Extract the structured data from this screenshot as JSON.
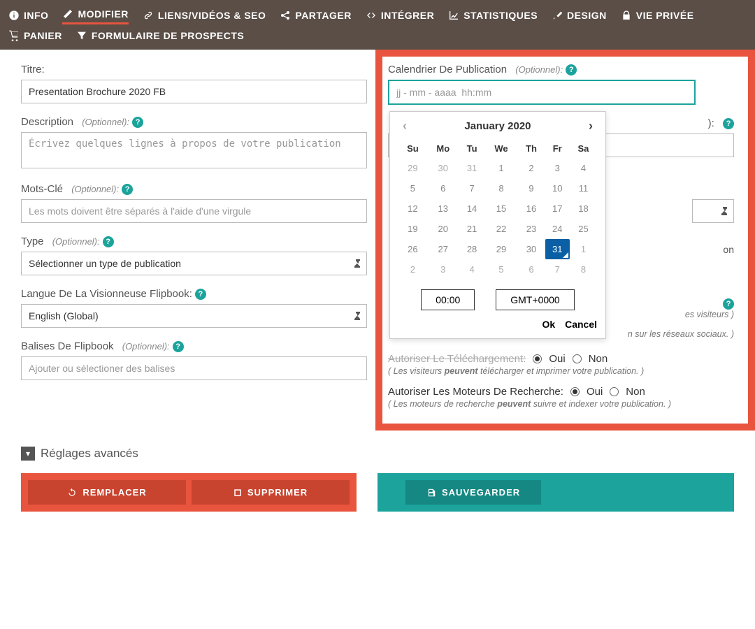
{
  "nav": {
    "info": "INFO",
    "modifier": "MODIFIER",
    "liens": "LIENS/VIDÉOS & SEO",
    "partager": "PARTAGER",
    "integrer": "INTÉGRER",
    "stats": "STATISTIQUES",
    "design": "DESIGN",
    "privacy": "VIE PRIVÉE",
    "panier": "PANIER",
    "leads": "FORMULAIRE DE PROSPECTS"
  },
  "left": {
    "titre_label": "Titre:",
    "titre_value": "Presentation Brochure 2020 FB",
    "desc_label": "Description",
    "desc_opt": "(Optionnel):",
    "desc_placeholder": "Écrivez quelques lignes à propos de votre publication",
    "keywords_label": "Mots-Clé",
    "keywords_opt": "(Optionnel):",
    "keywords_placeholder": "Les mots doivent être séparés à l'aide d'une virgule",
    "type_label": "Type",
    "type_opt": "(Optionnel):",
    "type_value": "Sélectionner un type de publication",
    "lang_label": "Langue De La Visionneuse Flipbook:",
    "lang_value": "English (Global)",
    "tags_label": "Balises De Flipbook",
    "tags_opt": "(Optionnel):",
    "tags_placeholder": "Ajouter ou sélectioner des balises"
  },
  "right": {
    "schedule_label": "Calendrier De Publication",
    "schedule_opt": "(Optionnel):",
    "schedule_placeholder": "jj - mm - aaaa  hh:mm",
    "hint_visitors": "es visiteurs )",
    "hint_social_suffix": "n sur les réseaux sociaux. )",
    "fragment_on": "on",
    "download_label": "Autoriser Le Téléchargement:",
    "download_hint_pre": "( Les visiteurs ",
    "download_hint_bold": "peuvent",
    "download_hint_post": " télécharger et imprimer votre publication. )",
    "search_label": "Autoriser Les Moteurs De Recherche:",
    "search_hint_pre": "( Les moteurs de recherche ",
    "search_hint_bold": "peuvent",
    "search_hint_post": " suivre et indexer votre publication. )",
    "oui": "Oui",
    "non": "Non"
  },
  "calendar": {
    "month": "January 2020",
    "dow": [
      "Su",
      "Mo",
      "Tu",
      "We",
      "Th",
      "Fr",
      "Sa"
    ],
    "weeks": [
      [
        {
          "d": "29"
        },
        {
          "d": "30"
        },
        {
          "d": "31"
        },
        {
          "d": "1",
          "in": true
        },
        {
          "d": "2",
          "in": true
        },
        {
          "d": "3",
          "in": true
        },
        {
          "d": "4",
          "in": true
        }
      ],
      [
        {
          "d": "5",
          "in": true
        },
        {
          "d": "6",
          "in": true
        },
        {
          "d": "7",
          "in": true
        },
        {
          "d": "8",
          "in": true
        },
        {
          "d": "9",
          "in": true
        },
        {
          "d": "10",
          "in": true
        },
        {
          "d": "11",
          "in": true
        }
      ],
      [
        {
          "d": "12",
          "in": true
        },
        {
          "d": "13",
          "in": true
        },
        {
          "d": "14",
          "in": true
        },
        {
          "d": "15",
          "in": true
        },
        {
          "d": "16",
          "in": true
        },
        {
          "d": "17",
          "in": true
        },
        {
          "d": "18",
          "in": true
        }
      ],
      [
        {
          "d": "19",
          "in": true
        },
        {
          "d": "20",
          "in": true
        },
        {
          "d": "21",
          "in": true
        },
        {
          "d": "22",
          "in": true
        },
        {
          "d": "23",
          "in": true
        },
        {
          "d": "24",
          "in": true
        },
        {
          "d": "25",
          "in": true
        }
      ],
      [
        {
          "d": "26",
          "in": true
        },
        {
          "d": "27",
          "in": true
        },
        {
          "d": "28",
          "in": true
        },
        {
          "d": "29",
          "in": true
        },
        {
          "d": "30",
          "in": true
        },
        {
          "d": "31",
          "in": true,
          "today": true
        },
        {
          "d": "1"
        }
      ],
      [
        {
          "d": "2"
        },
        {
          "d": "3"
        },
        {
          "d": "4"
        },
        {
          "d": "5"
        },
        {
          "d": "6"
        },
        {
          "d": "7"
        },
        {
          "d": "8"
        }
      ]
    ],
    "time": "00:00",
    "tz": "GMT+0000",
    "ok": "Ok",
    "cancel": "Cancel"
  },
  "advanced": "Réglages avancés",
  "buttons": {
    "replace": "REMPLACER",
    "delete": "SUPPRIMER",
    "save": "SAUVEGARDER"
  }
}
